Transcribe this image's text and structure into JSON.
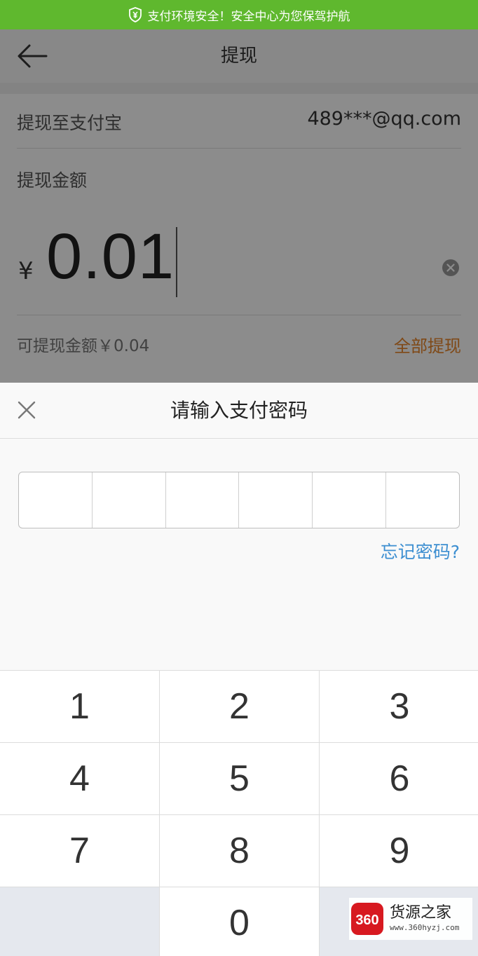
{
  "banner": {
    "text": "支付环境安全！安全中心为您保驾护航",
    "icon": "shield-yen-icon",
    "color": "#5fb82e"
  },
  "nav": {
    "title": "提现",
    "back_icon": "arrow-left-icon"
  },
  "form": {
    "to_label": "提现至支付宝",
    "to_account": "489***@qq.com",
    "amount_label": "提现金额",
    "currency": "¥",
    "amount": "0.01",
    "available": "可提现金额￥0.04",
    "withdraw_all": "全部提现"
  },
  "sheet": {
    "title": "请输入支付密码",
    "close_icon": "close-icon",
    "password_length": 6,
    "forgot": "忘记密码?"
  },
  "keypad": {
    "keys": [
      "1",
      "2",
      "3",
      "4",
      "5",
      "6",
      "7",
      "8",
      "9",
      "",
      "0",
      ""
    ]
  },
  "watermark": {
    "logo": "360",
    "brand": "货源之家",
    "url": "www.360hyzj.com"
  },
  "colors": {
    "accent_orange": "#e8862b",
    "link_blue": "#3d8fd1"
  }
}
